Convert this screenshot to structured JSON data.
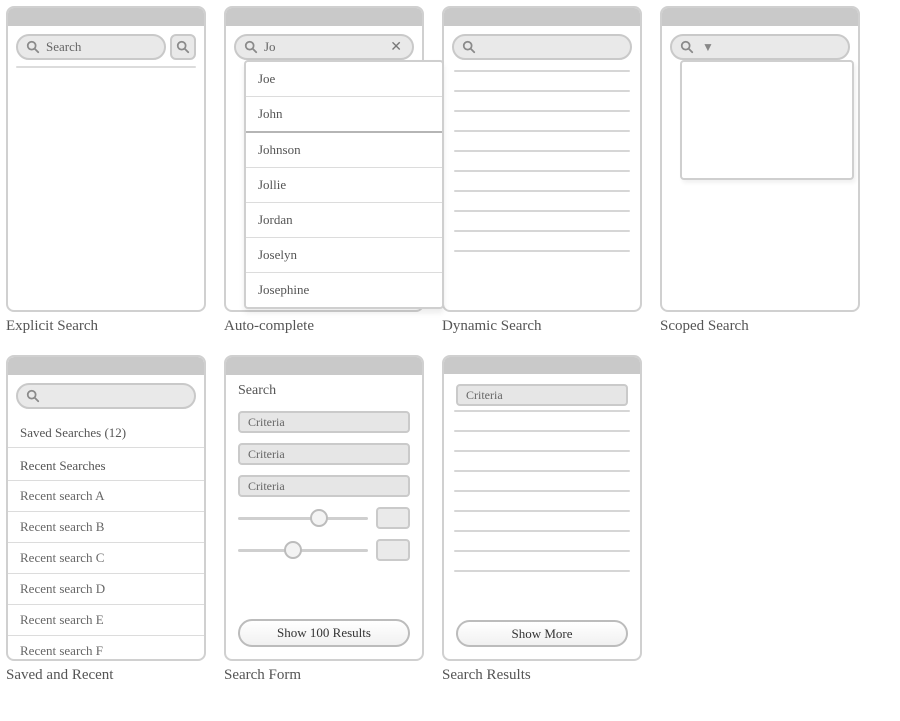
{
  "panels": {
    "explicit": {
      "caption": "Explicit Search",
      "placeholder": "Search"
    },
    "autocomplete": {
      "caption": "Auto-complete",
      "query": "Jo",
      "suggestions": [
        "Joe",
        "John",
        "Johnson",
        "Jollie",
        "Jordan",
        "Joselyn",
        "Josephine"
      ],
      "selected_index": 1
    },
    "dynamic": {
      "caption": "Dynamic Search",
      "result_rows": 10
    },
    "scoped": {
      "caption": "Scoped Search"
    },
    "saved_recent": {
      "caption": "Saved and Recent",
      "saved_label": "Saved Searches (12)",
      "recent_label": "Recent Searches",
      "recent": [
        "Recent search A",
        "Recent search B",
        "Recent search C",
        "Recent search D",
        "Recent search E",
        "Recent search F"
      ]
    },
    "form": {
      "caption": "Search Form",
      "title": "Search",
      "criteria_label": "Criteria",
      "slider1_pos": 0.55,
      "slider2_pos": 0.35,
      "button": "Show 100 Results"
    },
    "results": {
      "caption": "Search Results",
      "criteria_label": "Criteria",
      "result_rows": 9,
      "button": "Show More"
    }
  },
  "icons": {
    "magnifier_stroke": "#8a8a8a"
  }
}
